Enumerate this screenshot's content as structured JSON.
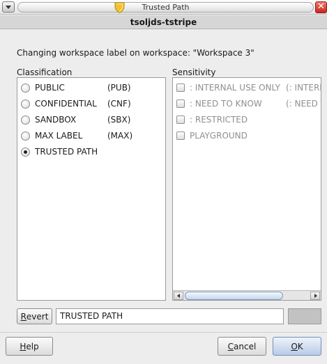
{
  "window": {
    "title": "Trusted Path",
    "close_glyph": "✕",
    "icons": {
      "menu": "window-menu-icon",
      "shield": "shield-icon",
      "close": "close-icon"
    }
  },
  "band": {
    "text": "tsoljds-tstripe"
  },
  "status": {
    "text": "Changing workspace label on workspace: \"Workspace 3\""
  },
  "classification": {
    "header": "Classification",
    "items": [
      {
        "name": "PUBLIC",
        "abbr": "(PUB)",
        "checked": false
      },
      {
        "name": "CONFIDENTIAL",
        "abbr": "(CNF)",
        "checked": false
      },
      {
        "name": "SANDBOX",
        "abbr": "(SBX)",
        "checked": false
      },
      {
        "name": "MAX LABEL",
        "abbr": "(MAX)",
        "checked": false
      },
      {
        "name": "TRUSTED PATH",
        "abbr": "",
        "checked": true
      }
    ]
  },
  "sensitivity": {
    "header": "Sensitivity",
    "items": [
      {
        "name": ": INTERNAL USE ONLY",
        "abbr": "(: INTERNA",
        "enabled": false
      },
      {
        "name": ": NEED TO KNOW",
        "abbr": "(: NEED TO",
        "enabled": false
      },
      {
        "name": ": RESTRICTED",
        "abbr": "",
        "enabled": false
      },
      {
        "name": "PLAYGROUND",
        "abbr": "",
        "enabled": false
      }
    ]
  },
  "label_field": {
    "value": "TRUSTED PATH"
  },
  "buttons": {
    "revert": {
      "mnemonic": "R",
      "rest": "evert"
    },
    "help": {
      "mnemonic": "H",
      "rest": "elp"
    },
    "cancel": {
      "mnemonic": "C",
      "rest": "ancel"
    },
    "ok": {
      "mnemonic": "O",
      "rest": "K"
    }
  },
  "colors": {
    "dialog_bg": "#ededed",
    "band_bg": "#d6d6d6",
    "swatch": "#c2c2c2",
    "close_red": "#c8261a",
    "shield_gold": "#f2c12e"
  }
}
